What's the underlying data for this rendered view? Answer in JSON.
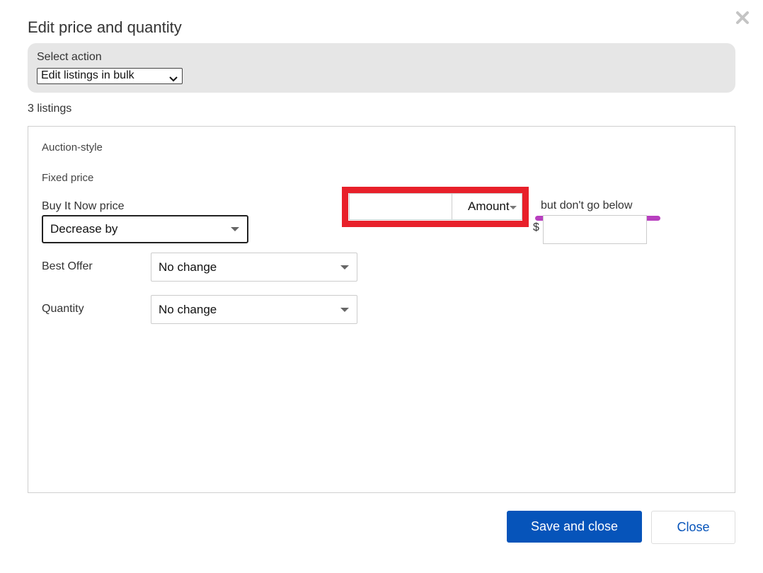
{
  "dialog": {
    "title": "Edit price and quantity",
    "close_icon": "close-icon"
  },
  "action": {
    "label": "Select action",
    "selected": "Edit listings in bulk"
  },
  "listing_count": "3 listings",
  "sections": {
    "auction": "Auction-style",
    "fixed": "Fixed price"
  },
  "buy_it_now": {
    "label": "Buy It Now price",
    "mode": "Decrease by",
    "amount_value": "",
    "amount_unit": "Amount",
    "min_label": "but don't go below",
    "currency": "$",
    "min_value": ""
  },
  "best_offer": {
    "label": "Best Offer",
    "value": "No change"
  },
  "quantity": {
    "label": "Quantity",
    "value": "No change"
  },
  "buttons": {
    "save": "Save and close",
    "close": "Close"
  },
  "colors": {
    "primary": "#0654ba",
    "highlight_box": "#e8202a",
    "underline_mark": "#b83fbf",
    "action_panel": "#e6e6e6"
  }
}
